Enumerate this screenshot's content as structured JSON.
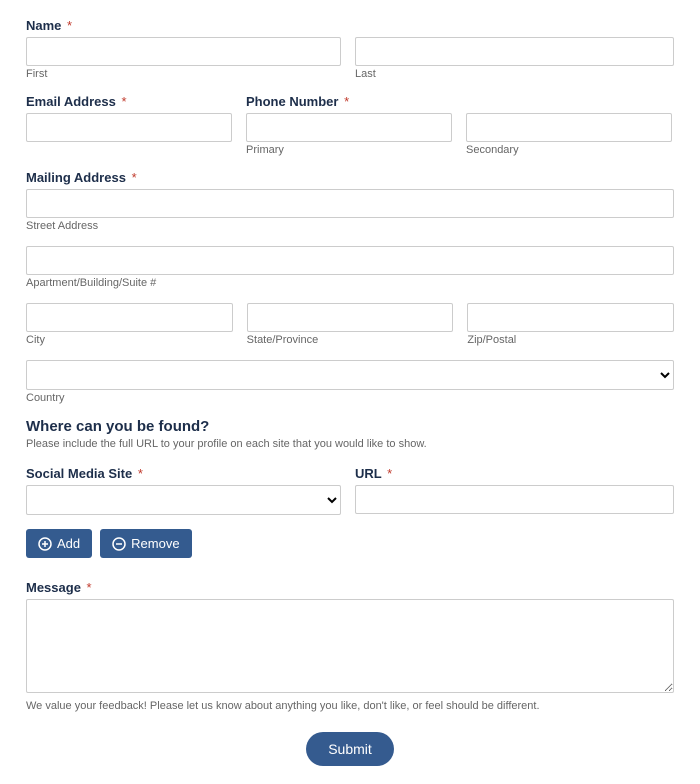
{
  "name": {
    "label": "Name",
    "first_sub": "First",
    "last_sub": "Last"
  },
  "email": {
    "label": "Email Address"
  },
  "phone": {
    "label": "Phone Number",
    "primary_sub": "Primary",
    "secondary_sub": "Secondary"
  },
  "mailing": {
    "label": "Mailing Address",
    "street_sub": "Street Address",
    "apt_sub": "Apartment/Building/Suite #",
    "city_sub": "City",
    "state_sub": "State/Province",
    "zip_sub": "Zip/Postal",
    "country_sub": "Country"
  },
  "find": {
    "heading": "Where can you be found?",
    "desc": "Please include the full URL to your profile on each site that you would like to show."
  },
  "social": {
    "label": "Social Media Site"
  },
  "url": {
    "label": "URL"
  },
  "buttons": {
    "add": "Add",
    "remove": "Remove",
    "submit": "Submit"
  },
  "message": {
    "label": "Message",
    "helper": "We value your feedback! Please let us know about anything you like, don't like, or feel should be different."
  },
  "req_mark": "*"
}
